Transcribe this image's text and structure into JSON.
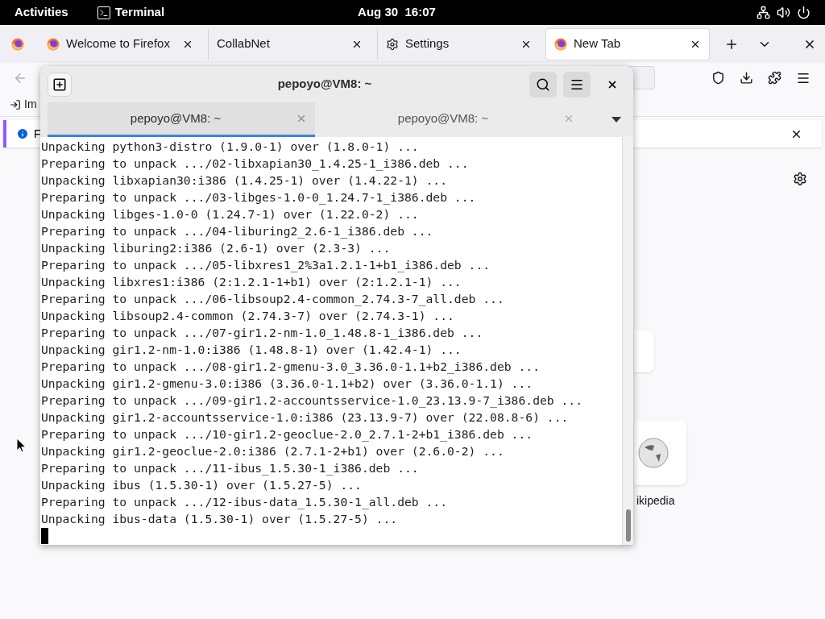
{
  "top_bar": {
    "activities": "Activities",
    "app": "Terminal",
    "clock": "Aug 30  16:07"
  },
  "browser": {
    "tabs": [
      {
        "title": "Welcome to Firefox",
        "kind": "firefox",
        "selected": false
      },
      {
        "title": "CollabNet",
        "kind": "plain",
        "selected": false
      },
      {
        "title": "Settings",
        "kind": "settings",
        "selected": false
      },
      {
        "title": "New Tab",
        "kind": "firefox",
        "selected": true
      }
    ],
    "bookmark": "Im",
    "notification": "F",
    "shortcut": "ikipedia"
  },
  "terminal": {
    "title": "pepoyo@VM8: ~",
    "tabs": [
      {
        "title": "pepoyo@VM8: ~",
        "selected": true
      },
      {
        "title": "pepoyo@VM8: ~",
        "selected": false
      }
    ],
    "lines": [
      "Unpacking python3-distro (1.9.0-1) over (1.8.0-1) ...",
      "Preparing to unpack .../02-libxapian30_1.4.25-1_i386.deb ...",
      "Unpacking libxapian30:i386 (1.4.25-1) over (1.4.22-1) ...",
      "Preparing to unpack .../03-libges-1.0-0_1.24.7-1_i386.deb ...",
      "Unpacking libges-1.0-0 (1.24.7-1) over (1.22.0-2) ...",
      "Preparing to unpack .../04-liburing2_2.6-1_i386.deb ...",
      "Unpacking liburing2:i386 (2.6-1) over (2.3-3) ...",
      "Preparing to unpack .../05-libxres1_2%3a1.2.1-1+b1_i386.deb ...",
      "Unpacking libxres1:i386 (2:1.2.1-1+b1) over (2:1.2.1-1) ...",
      "Preparing to unpack .../06-libsoup2.4-common_2.74.3-7_all.deb ...",
      "Unpacking libsoup2.4-common (2.74.3-7) over (2.74.3-1) ...",
      "Preparing to unpack .../07-gir1.2-nm-1.0_1.48.8-1_i386.deb ...",
      "Unpacking gir1.2-nm-1.0:i386 (1.48.8-1) over (1.42.4-1) ...",
      "Preparing to unpack .../08-gir1.2-gmenu-3.0_3.36.0-1.1+b2_i386.deb ...",
      "Unpacking gir1.2-gmenu-3.0:i386 (3.36.0-1.1+b2) over (3.36.0-1.1) ...",
      "Preparing to unpack .../09-gir1.2-accountsservice-1.0_23.13.9-7_i386.deb ...",
      "Unpacking gir1.2-accountsservice-1.0:i386 (23.13.9-7) over (22.08.8-6) ...",
      "Preparing to unpack .../10-gir1.2-geoclue-2.0_2.7.1-2+b1_i386.deb ...",
      "Unpacking gir1.2-geoclue-2.0:i386 (2.7.1-2+b1) over (2.6.0-2) ...",
      "Preparing to unpack .../11-ibus_1.5.30-1_i386.deb ...",
      "Unpacking ibus (1.5.30-1) over (1.5.27-5) ...",
      "Preparing to unpack .../12-ibus-data_1.5.30-1_all.deb ...",
      "Unpacking ibus-data (1.5.30-1) over (1.5.27-5) ..."
    ]
  }
}
